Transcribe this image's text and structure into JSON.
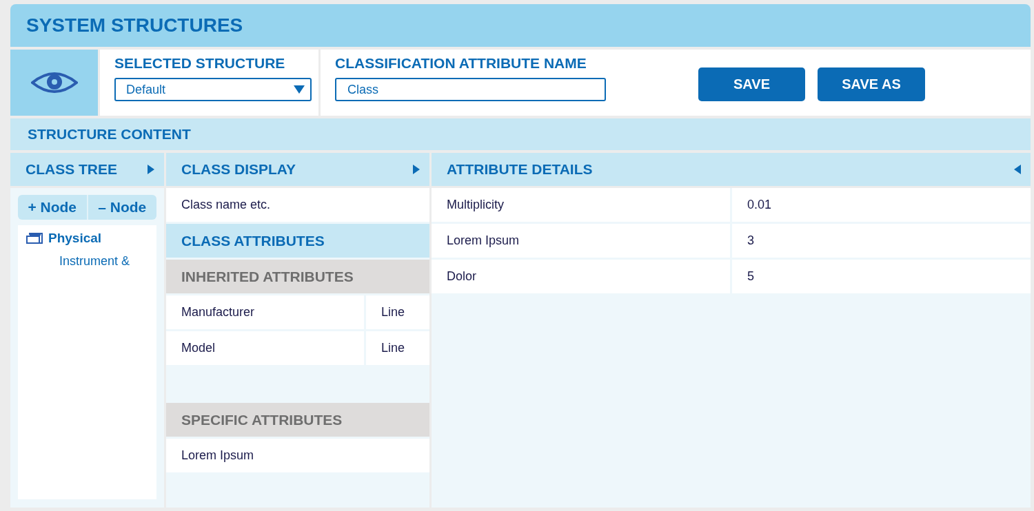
{
  "window": {
    "title": "SYSTEM STRUCTURES"
  },
  "selected_structure": {
    "label": "SELECTED STRUCTURE",
    "value": "Default"
  },
  "classification_attribute": {
    "label": "CLASSIFICATION ATTRIBUTE NAME",
    "value": "Class"
  },
  "buttons": [
    "SAVE",
    "SAVE AS"
  ],
  "structure_content": {
    "title": "STRUCTURE CONTENT"
  },
  "class_tree": {
    "title": "CLASS TREE",
    "tree_buttons": [
      "+ Node",
      "– Node"
    ],
    "items": [
      {
        "label": "Physical",
        "children": [
          {
            "label": "Instrument &"
          }
        ]
      }
    ]
  },
  "class_display": {
    "title": "CLASS DISPLAY",
    "rows": [
      {
        "kind": "text",
        "label": "Class name etc."
      },
      {
        "kind": "section",
        "label": "CLASS ATTRIBUTES",
        "selected": true
      },
      {
        "kind": "subsection",
        "label": "INHERITED ATTRIBUTES"
      },
      {
        "kind": "pair",
        "label": "Manufacturer",
        "value": "Line"
      },
      {
        "kind": "pair",
        "label": "Model",
        "value": "Line"
      },
      {
        "kind": "blank"
      },
      {
        "kind": "subsection",
        "label": "SPECIFIC ATTRIBUTES"
      },
      {
        "kind": "text",
        "label": "Lorem Ipsum"
      }
    ]
  },
  "attribute_details": {
    "title": "ATTRIBUTE DETAILS",
    "rows": [
      {
        "name": "Multiplicity",
        "value": "0.01"
      },
      {
        "name": "Lorem Ipsum",
        "value": "3"
      },
      {
        "name": "Dolor",
        "value": "5"
      }
    ]
  }
}
